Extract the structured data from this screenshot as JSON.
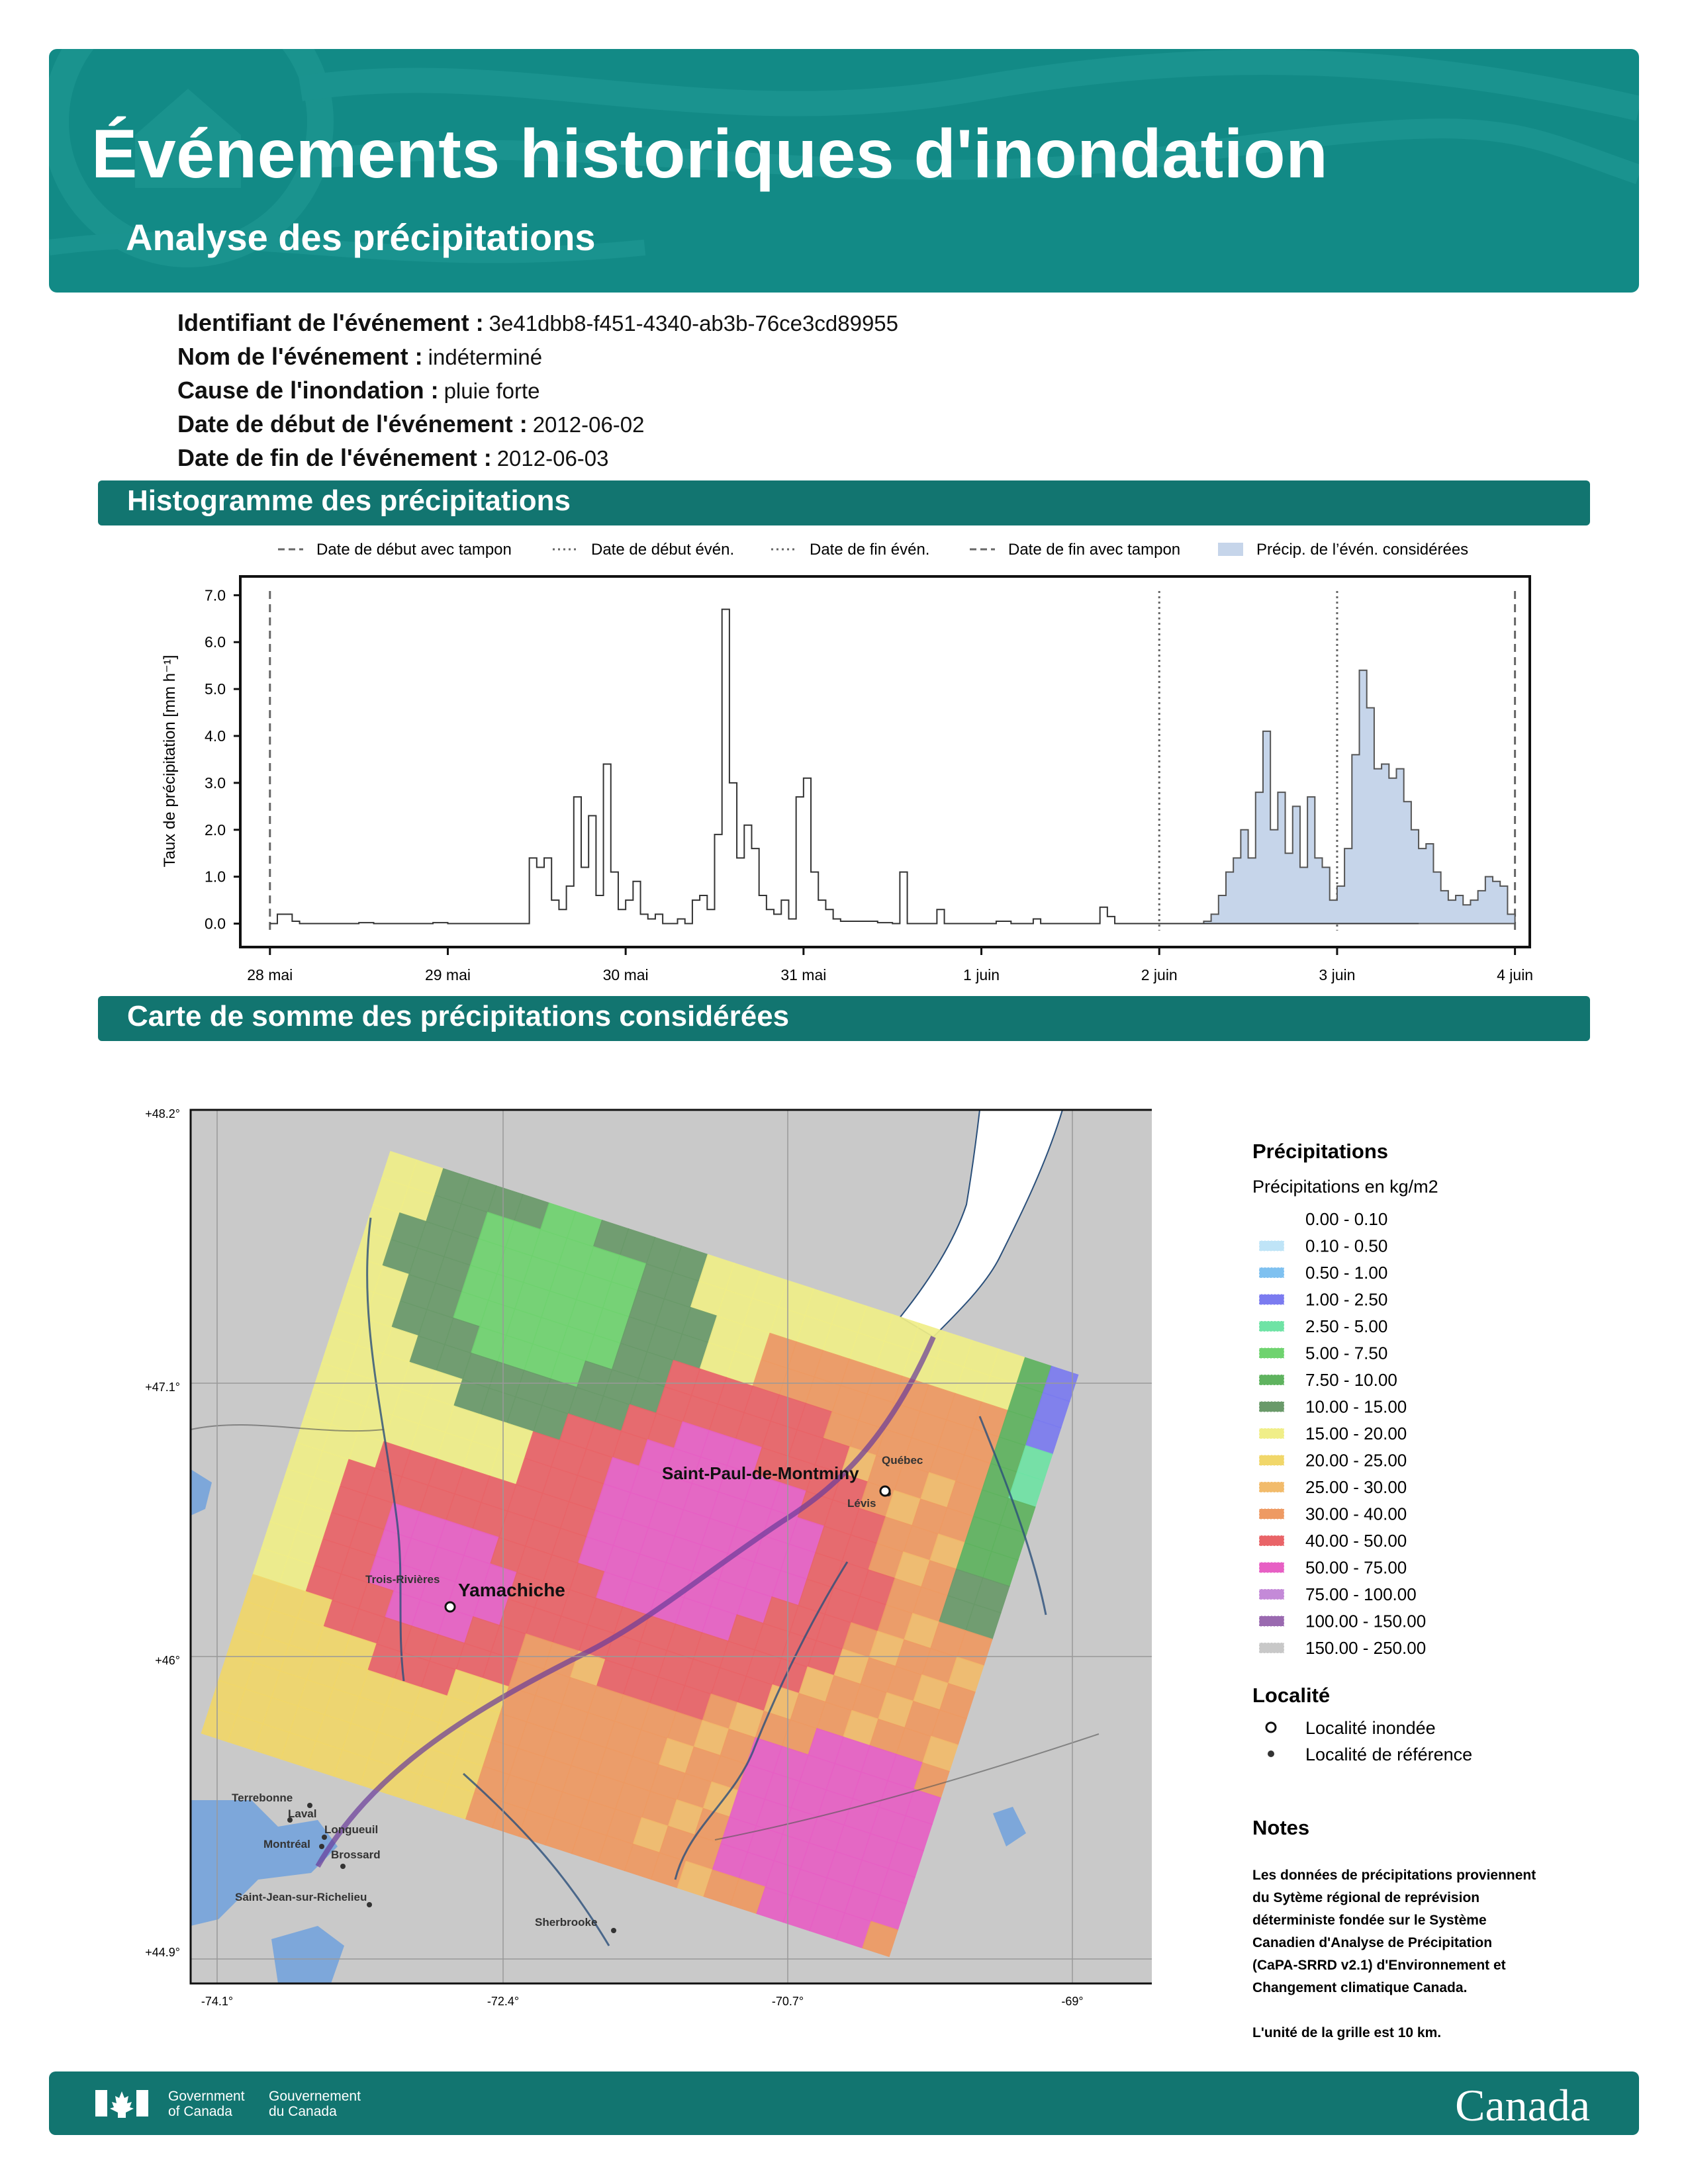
{
  "header": {
    "title": "Événements historiques d'inondation",
    "subtitle": "Analyse des précipitations"
  },
  "event": [
    {
      "label": "Identifiant de l'événement :",
      "value": "3e41dbb8-f451-4340-ab3b-76ce3cd89955"
    },
    {
      "label": "Nom de l'événement :",
      "value": "indéterminé"
    },
    {
      "label": "Cause de l'inondation :",
      "value": "pluie forte"
    },
    {
      "label": "Date de début de l'événement :",
      "value": "2012-06-02"
    },
    {
      "label": "Date de fin de l'événement :",
      "value": "2012-06-03"
    }
  ],
  "sections": {
    "histogram": "Histogramme des précipitations",
    "map": "Carte de somme des précipitations considérées"
  },
  "chart_data": [
    {
      "type": "histogram",
      "ylabel": "Taux de précipitation [mm h⁻¹]",
      "ylim": [
        -0.5,
        7.4
      ],
      "yticks": [
        "0.0",
        "1.0",
        "2.0",
        "3.0",
        "4.0",
        "5.0",
        "6.0",
        "7.0"
      ],
      "xlim": [
        "2012-05-27T20:00",
        "2012-06-04T02:00"
      ],
      "xticks": [
        "28 mai",
        "29 mai",
        "30 mai",
        "31 mai",
        "1 juin",
        "2 juin",
        "3 juin",
        "4 juin"
      ],
      "legend_position": "top",
      "legend": [
        {
          "label": "Date de début avec tampon",
          "style": "dashed"
        },
        {
          "label": "Date de début évén.",
          "style": "dotted"
        },
        {
          "label": "Date de fin évén.",
          "style": "dotted"
        },
        {
          "label": "Date de fin avec tampon",
          "style": "dashed"
        },
        {
          "label": "Précip. de l’évén. considérées",
          "style": "fill"
        }
      ],
      "vlines": [
        {
          "time": "2012-05-28T00:00",
          "style": "dashed"
        },
        {
          "time": "2012-06-02T00:00",
          "style": "dotted"
        },
        {
          "time": "2012-06-03T00:00",
          "style": "dotted"
        },
        {
          "time": "2012-06-04T00:00",
          "style": "dashed"
        }
      ],
      "series": [
        {
          "style": "step",
          "color": "#333333",
          "points": [
            [
              "2012-05-28T00:00",
              0.0
            ],
            [
              "2012-05-28T01:00",
              0.2
            ],
            [
              "2012-05-28T03:00",
              0.05
            ],
            [
              "2012-05-28T04:00",
              0.0
            ],
            [
              "2012-05-28T12:00",
              0.02
            ],
            [
              "2012-05-28T14:00",
              0.0
            ],
            [
              "2012-05-28T22:00",
              0.02
            ],
            [
              "2012-05-29T00:00",
              0.0
            ],
            [
              "2012-05-29T11:00",
              1.4
            ],
            [
              "2012-05-29T12:00",
              1.2
            ],
            [
              "2012-05-29T13:00",
              1.4
            ],
            [
              "2012-05-29T14:00",
              0.5
            ],
            [
              "2012-05-29T15:00",
              0.3
            ],
            [
              "2012-05-29T16:00",
              0.8
            ],
            [
              "2012-05-29T17:00",
              2.7
            ],
            [
              "2012-05-29T18:00",
              1.2
            ],
            [
              "2012-05-29T19:00",
              2.3
            ],
            [
              "2012-05-29T20:00",
              0.6
            ],
            [
              "2012-05-29T21:00",
              3.4
            ],
            [
              "2012-05-29T22:00",
              1.1
            ],
            [
              "2012-05-29T23:00",
              0.3
            ],
            [
              "2012-05-30T00:00",
              0.5
            ],
            [
              "2012-05-30T01:00",
              0.9
            ],
            [
              "2012-05-30T02:00",
              0.2
            ],
            [
              "2012-05-30T03:00",
              0.1
            ],
            [
              "2012-05-30T04:00",
              0.2
            ],
            [
              "2012-05-30T05:00",
              0.0
            ],
            [
              "2012-05-30T07:00",
              0.1
            ],
            [
              "2012-05-30T08:00",
              0.0
            ],
            [
              "2012-05-30T09:00",
              0.5
            ],
            [
              "2012-05-30T10:00",
              0.6
            ],
            [
              "2012-05-30T11:00",
              0.3
            ],
            [
              "2012-05-30T12:00",
              1.9
            ],
            [
              "2012-05-30T13:00",
              6.7
            ],
            [
              "2012-05-30T14:00",
              3.0
            ],
            [
              "2012-05-30T15:00",
              1.4
            ],
            [
              "2012-05-30T16:00",
              2.1
            ],
            [
              "2012-05-30T17:00",
              1.6
            ],
            [
              "2012-05-30T18:00",
              0.6
            ],
            [
              "2012-05-30T19:00",
              0.3
            ],
            [
              "2012-05-30T20:00",
              0.2
            ],
            [
              "2012-05-30T21:00",
              0.5
            ],
            [
              "2012-05-30T22:00",
              0.1
            ],
            [
              "2012-05-30T23:00",
              2.7
            ],
            [
              "2012-05-31T00:00",
              3.1
            ],
            [
              "2012-05-31T01:00",
              1.1
            ],
            [
              "2012-05-31T02:00",
              0.5
            ],
            [
              "2012-05-31T03:00",
              0.3
            ],
            [
              "2012-05-31T04:00",
              0.1
            ],
            [
              "2012-05-31T05:00",
              0.05
            ],
            [
              "2012-05-31T10:00",
              0.02
            ],
            [
              "2012-05-31T12:00",
              0.0
            ],
            [
              "2012-05-31T13:00",
              1.1
            ],
            [
              "2012-05-31T14:00",
              0.0
            ],
            [
              "2012-05-31T18:00",
              0.3
            ],
            [
              "2012-05-31T19:00",
              0.0
            ],
            [
              "2012-06-01T02:00",
              0.05
            ],
            [
              "2012-06-01T04:00",
              0.0
            ],
            [
              "2012-06-01T07:00",
              0.1
            ],
            [
              "2012-06-01T08:00",
              0.0
            ],
            [
              "2012-06-01T16:00",
              0.35
            ],
            [
              "2012-06-01T17:00",
              0.15
            ],
            [
              "2012-06-01T18:00",
              0.0
            ],
            [
              "2012-06-03T10:00",
              0.0
            ]
          ]
        },
        {
          "style": "filled-step",
          "color": "#c6d5ea",
          "edge": "#555555",
          "points": [
            [
              "2012-06-02T06:00",
              0.05
            ],
            [
              "2012-06-02T07:00",
              0.2
            ],
            [
              "2012-06-02T08:00",
              0.6
            ],
            [
              "2012-06-02T09:00",
              1.1
            ],
            [
              "2012-06-02T10:00",
              1.4
            ],
            [
              "2012-06-02T11:00",
              2.0
            ],
            [
              "2012-06-02T12:00",
              1.4
            ],
            [
              "2012-06-02T13:00",
              2.8
            ],
            [
              "2012-06-02T14:00",
              4.1
            ],
            [
              "2012-06-02T15:00",
              2.0
            ],
            [
              "2012-06-02T16:00",
              2.8
            ],
            [
              "2012-06-02T17:00",
              1.5
            ],
            [
              "2012-06-02T18:00",
              2.5
            ],
            [
              "2012-06-02T19:00",
              1.2
            ],
            [
              "2012-06-02T20:00",
              2.7
            ],
            [
              "2012-06-02T21:00",
              1.4
            ],
            [
              "2012-06-02T22:00",
              1.2
            ],
            [
              "2012-06-02T23:00",
              0.5
            ],
            [
              "2012-06-03T00:00",
              0.8
            ],
            [
              "2012-06-03T01:00",
              1.6
            ],
            [
              "2012-06-03T02:00",
              3.6
            ],
            [
              "2012-06-03T03:00",
              5.4
            ],
            [
              "2012-06-03T04:00",
              4.6
            ],
            [
              "2012-06-03T05:00",
              3.3
            ],
            [
              "2012-06-03T06:00",
              3.4
            ],
            [
              "2012-06-03T07:00",
              3.1
            ],
            [
              "2012-06-03T08:00",
              3.3
            ],
            [
              "2012-06-03T09:00",
              2.6
            ],
            [
              "2012-06-03T10:00",
              2.0
            ],
            [
              "2012-06-03T11:00",
              1.6
            ],
            [
              "2012-06-03T12:00",
              1.7
            ],
            [
              "2012-06-03T13:00",
              1.1
            ],
            [
              "2012-06-03T14:00",
              0.7
            ],
            [
              "2012-06-03T15:00",
              0.5
            ],
            [
              "2012-06-03T16:00",
              0.6
            ],
            [
              "2012-06-03T17:00",
              0.4
            ],
            [
              "2012-06-03T18:00",
              0.5
            ],
            [
              "2012-06-03T19:00",
              0.7
            ],
            [
              "2012-06-03T20:00",
              1.0
            ],
            [
              "2012-06-03T21:00",
              0.9
            ],
            [
              "2012-06-03T22:00",
              0.8
            ],
            [
              "2012-06-03T23:00",
              0.2
            ]
          ]
        }
      ]
    },
    {
      "type": "heatmap",
      "title": "",
      "lat_ticks": [
        "+48.2°",
        "+47.1°",
        "+46°",
        "+44.9°"
      ],
      "lon_ticks": [
        "-74.1°",
        "-72.4°",
        "-70.7°",
        "-69°"
      ],
      "lat_range": [
        44.9,
        48.2
      ],
      "lon_range": [
        -74.8,
        -69.2
      ],
      "grid_unit_note": "L'unité de la grille est 10 km.",
      "legend": {
        "title": "Précipitations",
        "subtitle": "Précipitations en kg/m2",
        "bins": [
          {
            "range": "0.00 - 0.10",
            "color": "#ffffff"
          },
          {
            "range": "0.10 - 0.50",
            "color": "#bfe4f7"
          },
          {
            "range": "0.50 - 1.00",
            "color": "#7fc1f0"
          },
          {
            "range": "1.00 - 2.50",
            "color": "#7b7bf0"
          },
          {
            "range": "2.50 - 5.00",
            "color": "#6fe3a5"
          },
          {
            "range": "5.00 - 7.50",
            "color": "#6fd36f"
          },
          {
            "range": "7.50 - 10.00",
            "color": "#5fb35f"
          },
          {
            "range": "10.00 - 15.00",
            "color": "#6a9a6a"
          },
          {
            "range": "15.00 - 20.00",
            "color": "#f0ee88"
          },
          {
            "range": "20.00 - 25.00",
            "color": "#f1d76a"
          },
          {
            "range": "25.00 - 30.00",
            "color": "#f2bb6b"
          },
          {
            "range": "30.00 - 40.00",
            "color": "#ee9a63"
          },
          {
            "range": "40.00 - 50.00",
            "color": "#e96468"
          },
          {
            "range": "50.00 - 75.00",
            "color": "#e760c4"
          },
          {
            "range": "75.00 - 100.00",
            "color": "#c48ad8"
          },
          {
            "range": "100.00 - 150.00",
            "color": "#9a6ab0"
          },
          {
            "range": "150.00 - 250.00",
            "color": "#c8c8c8"
          }
        ]
      },
      "locality_legend": {
        "title": "Localité",
        "items": [
          {
            "label": "Localité inondée",
            "marker": "open-circle"
          },
          {
            "label": "Localité de référence",
            "marker": "dot"
          }
        ]
      },
      "localities": [
        {
          "name": "Saint-Paul-de-Montminy",
          "lon": -70.5,
          "lat": 46.75,
          "type": "flooded"
        },
        {
          "name": "Yamachiche",
          "lon": -72.8,
          "lat": 46.25,
          "type": "flooded"
        }
      ],
      "reference_places": [
        {
          "name": "Québec",
          "lon": -71.1,
          "lat": 46.86
        },
        {
          "name": "Lévis",
          "lon": -71.2,
          "lat": 46.78
        },
        {
          "name": "Trois-Rivières",
          "lon": -72.55,
          "lat": 46.35
        },
        {
          "name": "Terrebonne",
          "lon": -73.65,
          "lat": 45.72
        },
        {
          "name": "Laval",
          "lon": -73.7,
          "lat": 45.6
        },
        {
          "name": "Longueuil",
          "lon": -73.5,
          "lat": 45.53
        },
        {
          "name": "Montréal",
          "lon": -73.58,
          "lat": 45.5
        },
        {
          "name": "Brossard",
          "lon": -73.45,
          "lat": 45.45
        },
        {
          "name": "Saint-Jean-sur-Richelieu",
          "lon": -73.26,
          "lat": 45.3
        },
        {
          "name": "Sherbrooke",
          "lon": -71.9,
          "lat": 45.4
        }
      ]
    }
  ],
  "notes": {
    "title": "Notes",
    "lines": [
      "Les données de précipitations proviennent",
      "du Sytème régional de reprévision",
      "déterministe fondée sur le Système",
      "Canadien d'Analyse de Précipitation",
      "(CaPA-SRRD v2.1) d'Environnement et",
      "Changement climatique Canada."
    ],
    "unit": "L'unité de la grille est 10 km."
  },
  "footer": {
    "gov_en": [
      "Government",
      "of Canada"
    ],
    "gov_fr": [
      "Gouvernement",
      "du Canada"
    ],
    "wordmark": "Canada"
  },
  "colors": {
    "banner": "#128a86",
    "section": "#127570",
    "land": "#c9c9c9",
    "water": "#ffffff",
    "lake": "#7da7da"
  }
}
